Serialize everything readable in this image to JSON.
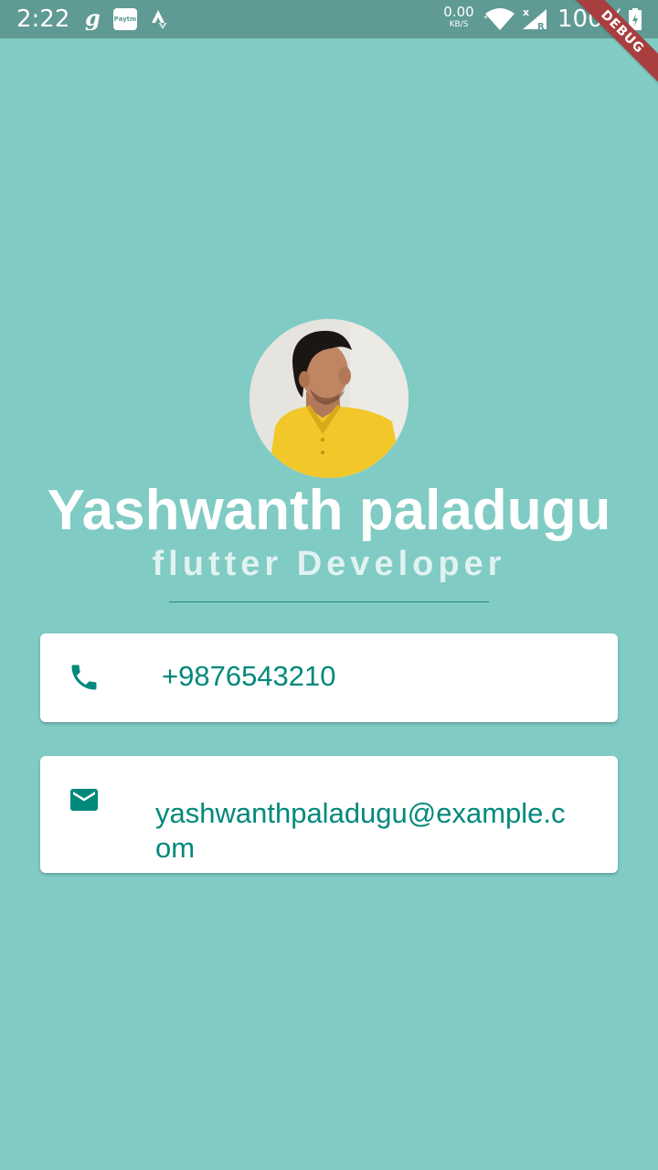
{
  "status_bar": {
    "time": "2:22",
    "net_speed_value": "0.00",
    "net_speed_unit": "KB/S",
    "battery_percent": "100%",
    "paytm_label": "Paytm",
    "icons": [
      "g-app-icon",
      "paytm-icon",
      "strava-icon",
      "wifi-icon",
      "signal-icon",
      "battery-charging-icon"
    ]
  },
  "debug_banner": "DEBUG",
  "profile": {
    "name": "Yashwanth paladugu",
    "title": "flutter Developer"
  },
  "contact": {
    "phone": "+9876543210",
    "email": "yashwanthpaladugu@example.com"
  },
  "colors": {
    "background": "#80CBC4",
    "accent": "#00897B",
    "card": "#FFFFFF",
    "status_bar": "#5F9A94",
    "debug_ribbon": "#A83E3E"
  }
}
